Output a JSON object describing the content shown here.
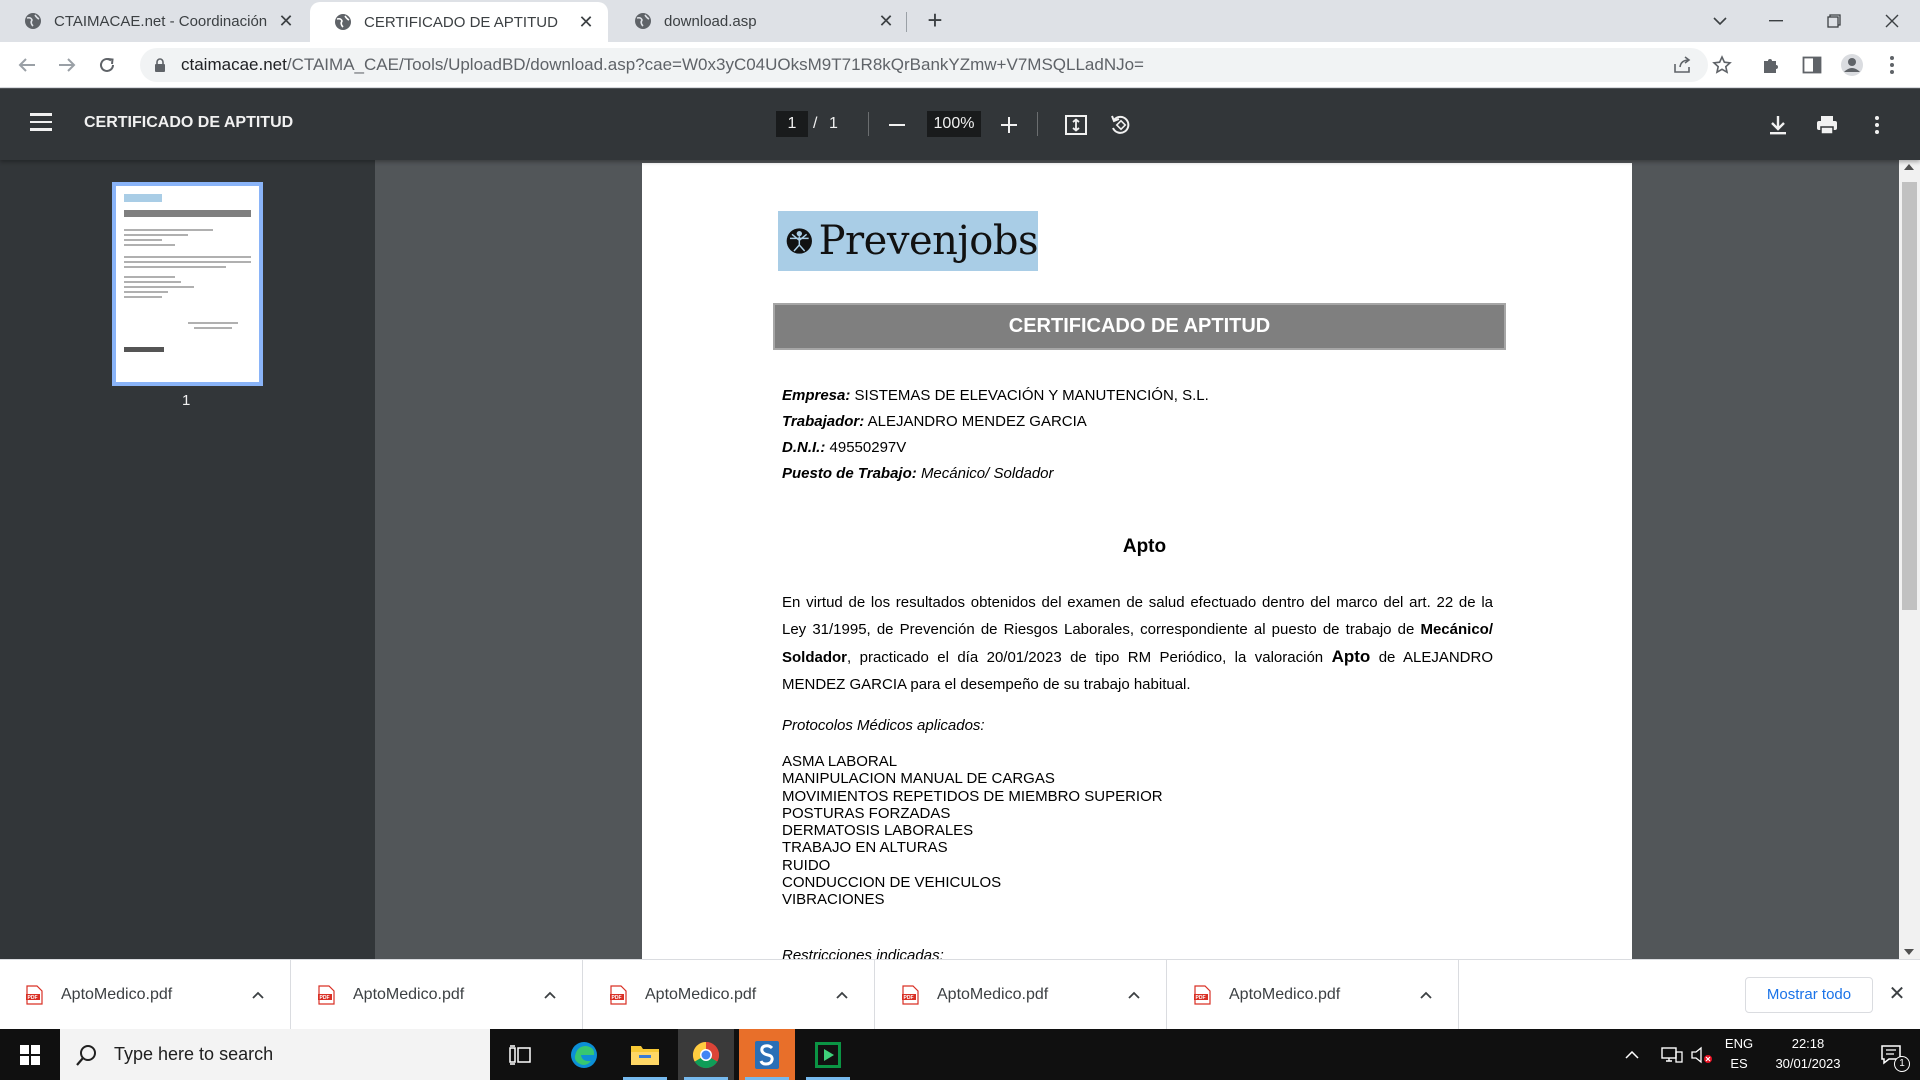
{
  "browser": {
    "tabs": [
      {
        "title": "CTAIMACAE.net - Coordinación d",
        "active": false
      },
      {
        "title": "CERTIFICADO DE APTITUD",
        "active": true
      },
      {
        "title": "download.asp",
        "active": false
      }
    ],
    "url_host": "ctaimacae.net",
    "url_path": "/CTAIMA_CAE/Tools/UploadBD/download.asp?cae=W0x3yC04UOksM9T71R8kQrBankYZmw+V7MSQLLadNJo="
  },
  "viewer": {
    "title": "CERTIFICADO DE APTITUD",
    "page_current": "1",
    "page_sep": "/",
    "page_total": "1",
    "zoom": "100%",
    "thumb_number": "1"
  },
  "document": {
    "logo_text": "Prevenjobs",
    "heading": "CERTIFICADO DE APTITUD",
    "fields": [
      {
        "label": "Empresa:",
        "value": "SISTEMAS DE ELEVACIÓN Y MANUTENCIÓN, S.L."
      },
      {
        "label": "Trabajador:",
        "value": "ALEJANDRO MENDEZ GARCIA"
      },
      {
        "label": "D.N.I.:",
        "value": "49550297V"
      },
      {
        "label": "Puesto de Trabajo:",
        "value": "Mecánico/ Soldador"
      }
    ],
    "verdict": "Apto",
    "paragraph": {
      "part1": "En virtud de los resultados obtenidos del examen de salud efectuado dentro del marco del art. 22 de la Ley 31/1995, de Prevención de Riesgos Laborales, correspondiente al puesto de trabajo de ",
      "job_bold": "Mecánico/ Soldador",
      "part2": ", practicado el día 20/01/2023 de tipo RM Periódico, la valoración ",
      "apto_bold": "Apto",
      "part3": " de ALEJANDRO MENDEZ GARCIA para el desempeño de su trabajo habitual."
    },
    "protocols_title": "Protocolos Médicos aplicados:",
    "protocols": [
      "ASMA LABORAL",
      "MANIPULACION MANUAL DE CARGAS",
      "MOVIMIENTOS REPETIDOS DE MIEMBRO SUPERIOR",
      "POSTURAS FORZADAS",
      "DERMATOSIS LABORALES",
      "TRABAJO EN ALTURAS",
      "RUIDO",
      "CONDUCCION DE VEHICULOS",
      "VIBRACIONES"
    ],
    "restrictions_title": "Restricciones indicadas:"
  },
  "downloads": {
    "items": [
      "AptoMedico.pdf",
      "AptoMedico.pdf",
      "AptoMedico.pdf",
      "AptoMedico.pdf",
      "AptoMedico.pdf"
    ],
    "show_all": "Mostrar todo"
  },
  "taskbar": {
    "search_placeholder": "Type here to search",
    "lang_top": "ENG",
    "lang_bottom": "ES",
    "time": "22:18",
    "date": "30/01/2023",
    "notification_count": "1"
  },
  "colors": {
    "pdf_toolbar": "#323639",
    "doc_background": "#525659",
    "logo_highlight": "#a9cde6",
    "heading_bar": "#7f7f7f",
    "link_blue": "#1a73e8"
  }
}
